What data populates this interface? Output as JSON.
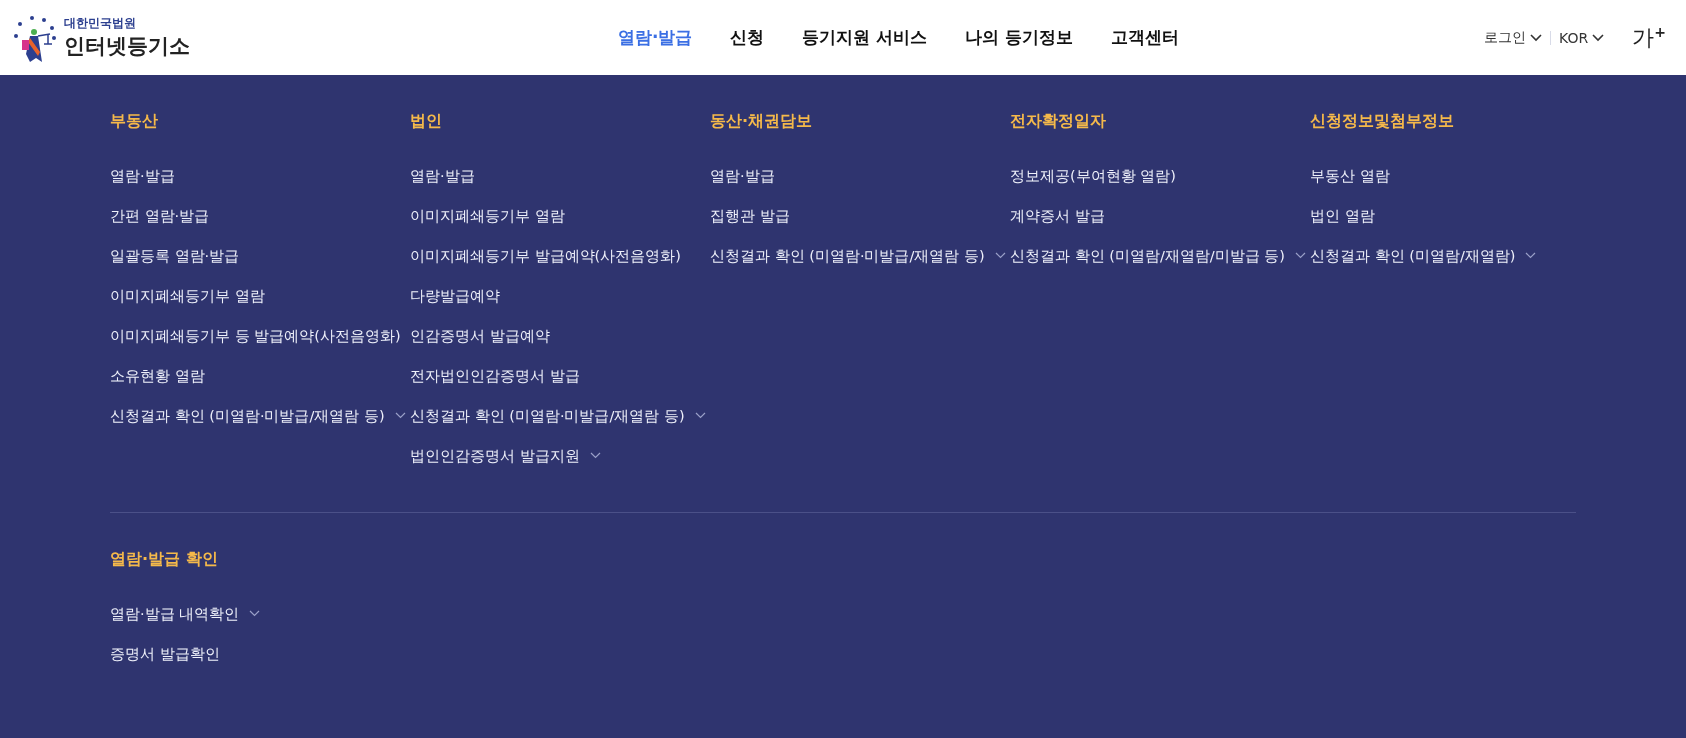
{
  "header": {
    "logo": {
      "org": "대한민국법원",
      "name": "인터넷등기소"
    },
    "nav": [
      {
        "label": "열람·발급",
        "selected": true
      },
      {
        "label": "신청",
        "selected": false
      },
      {
        "label": "등기지원 서비스",
        "selected": false
      },
      {
        "label": "나의 등기정보",
        "selected": false
      },
      {
        "label": "고객센터",
        "selected": false
      }
    ],
    "utility": {
      "login": "로그인",
      "language": "KOR",
      "font_size": "가",
      "font_size_mark": "+"
    }
  },
  "mega_menu": {
    "groups": [
      {
        "sections": [
          {
            "title": "부동산",
            "items": [
              {
                "label": "열람·발급",
                "expandable": false
              },
              {
                "label": "간편 열람·발급",
                "expandable": false
              },
              {
                "label": "일괄등록 열람·발급",
                "expandable": false
              },
              {
                "label": "이미지폐쇄등기부 열람",
                "expandable": false
              },
              {
                "label": "이미지폐쇄등기부 등 발급예약(사전음영화)",
                "expandable": false
              },
              {
                "label": "소유현황 열람",
                "expandable": false
              },
              {
                "label": "신청결과 확인 (미열람·미발급/재열람 등)",
                "expandable": true
              }
            ]
          },
          {
            "title": "법인",
            "items": [
              {
                "label": "열람·발급",
                "expandable": false
              },
              {
                "label": "이미지폐쇄등기부 열람",
                "expandable": false
              },
              {
                "label": "이미지폐쇄등기부 발급예약(사전음영화)",
                "expandable": false
              },
              {
                "label": "다량발급예약",
                "expandable": false
              },
              {
                "label": "인감증명서 발급예약",
                "expandable": false
              },
              {
                "label": "전자법인인감증명서 발급",
                "expandable": false
              },
              {
                "label": "신청결과 확인 (미열람·미발급/재열람 등)",
                "expandable": true
              },
              {
                "label": "법인인감증명서 발급지원",
                "expandable": true
              }
            ]
          },
          {
            "title": "동산·채권담보",
            "items": [
              {
                "label": "열람·발급",
                "expandable": false
              },
              {
                "label": "집행관 발급",
                "expandable": false
              },
              {
                "label": "신청결과 확인 (미열람·미발급/재열람 등)",
                "expandable": true
              }
            ]
          },
          {
            "title": "전자확정일자",
            "items": [
              {
                "label": "정보제공(부여현황 열람)",
                "expandable": false
              },
              {
                "label": "계약증서 발급",
                "expandable": false
              },
              {
                "label": "신청결과 확인 (미열람/재열람/미발급 등)",
                "expandable": true
              }
            ]
          },
          {
            "title": "신청정보및첨부정보",
            "items": [
              {
                "label": "부동산 열람",
                "expandable": false
              },
              {
                "label": "법인 열람",
                "expandable": false
              },
              {
                "label": "신청결과 확인 (미열람/재열람)",
                "expandable": true
              }
            ]
          }
        ]
      },
      {
        "sections": [
          {
            "title": "열람·발급 확인",
            "items": [
              {
                "label": "열람·발급 내역확인",
                "expandable": true
              },
              {
                "label": "증명서 발급확인",
                "expandable": false
              }
            ]
          }
        ]
      }
    ]
  }
}
